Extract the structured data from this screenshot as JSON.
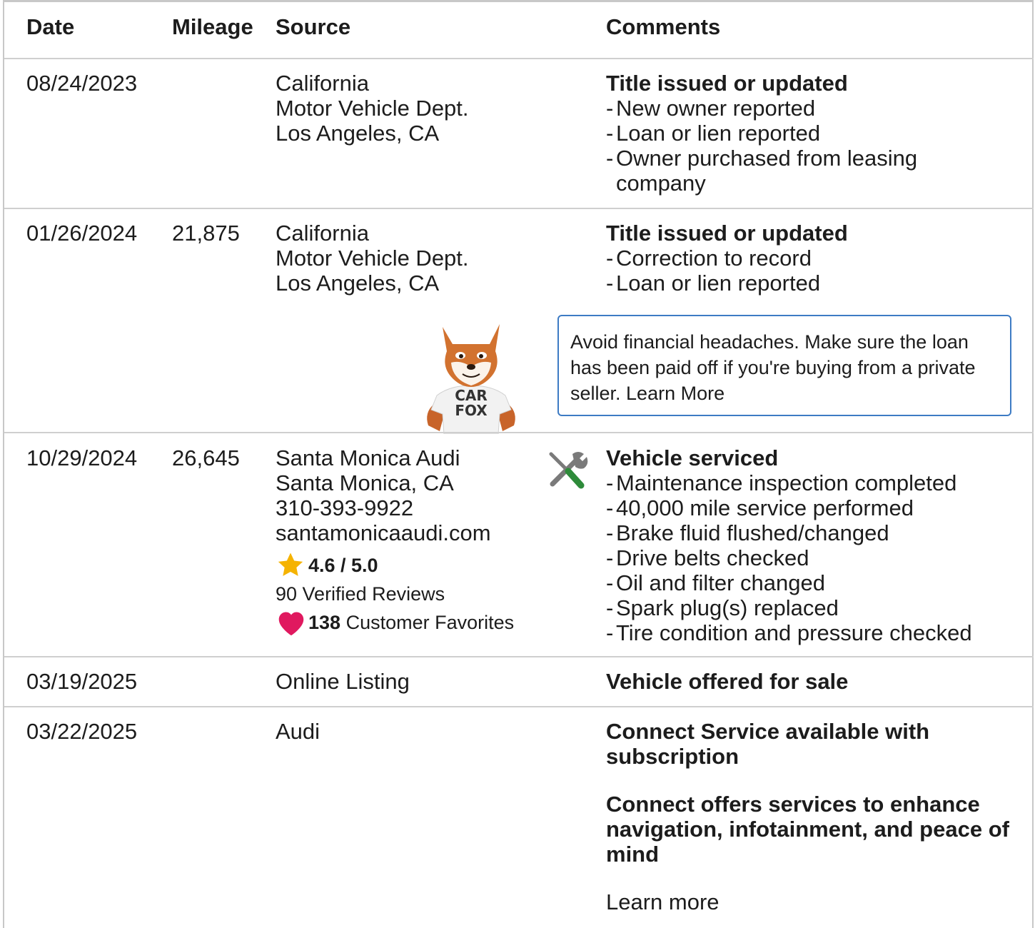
{
  "headers": {
    "date": "Date",
    "mileage": "Mileage",
    "source": "Source",
    "comments": "Comments"
  },
  "rows": [
    {
      "date": "08/24/2023",
      "mileage": "",
      "source": [
        "California",
        "Motor Vehicle Dept.",
        "Los Angeles, CA"
      ],
      "comment_title": "Title issued or updated",
      "comment_items": [
        "New owner reported",
        "Loan or lien reported",
        "Owner purchased from leasing company"
      ]
    },
    {
      "date": "01/26/2024",
      "mileage": "21,875",
      "source": [
        "California",
        "Motor Vehicle Dept.",
        "Los Angeles, CA"
      ],
      "comment_title": "Title issued or updated",
      "comment_items": [
        "Correction to record",
        "Loan or lien reported"
      ],
      "callout": "Avoid financial headaches. Make sure the loan has been paid off if you're buying from a private seller. Learn More",
      "mascot_shirt": [
        "CAR",
        "FOX"
      ]
    },
    {
      "date": "10/29/2024",
      "mileage": "26,645",
      "source": [
        "Santa Monica Audi",
        "Santa Monica, CA",
        "310-393-9922",
        "santamonicaaudi.com"
      ],
      "rating": "4.6 / 5.0",
      "reviews": "90 Verified Reviews",
      "favorites_count": "138",
      "favorites_label": " Customer Favorites",
      "icon": "wrench-screwdriver-icon",
      "comment_title": "Vehicle serviced",
      "comment_items": [
        "Maintenance inspection completed",
        "40,000 mile service performed",
        "Brake fluid flushed/changed",
        "Drive belts checked",
        "Oil and filter changed",
        "Spark plug(s) replaced",
        "Tire condition and pressure checked"
      ]
    },
    {
      "date": "03/19/2025",
      "mileage": "",
      "source": [
        "Online Listing"
      ],
      "comment_title": "Vehicle offered for sale"
    },
    {
      "date": "03/22/2025",
      "mileage": "",
      "source": [
        "Audi"
      ],
      "comment_title": "Connect Service available with subscription",
      "comment_title2": "Connect offers services to enhance navigation, infotainment, and peace of mind",
      "comment_link": "Learn more"
    }
  ],
  "colors": {
    "border": "#cfcfcf",
    "callout_border": "#3d7bc4",
    "star": "#f5b301",
    "heart": "#e0195f",
    "screwdriver_tip": "#2e8b3a"
  }
}
